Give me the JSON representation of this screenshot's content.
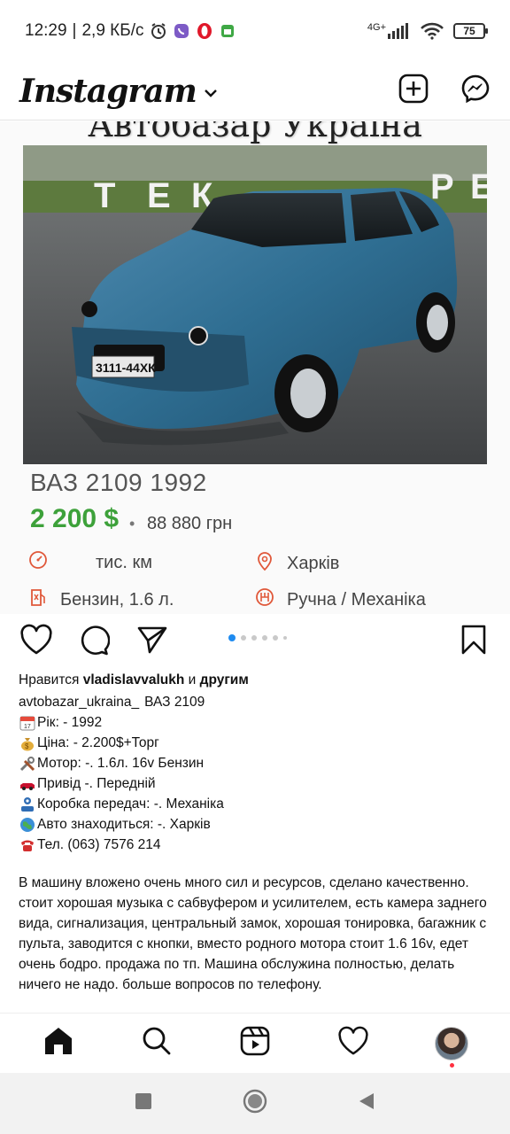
{
  "status": {
    "time": "12:29",
    "separator": "|",
    "speed": "2,9 КБ/с",
    "network": "4G+",
    "battery": "75"
  },
  "header": {
    "logo": "Instagram"
  },
  "post": {
    "image_title": "Автобазар Україна",
    "plate": "3111-44ХК",
    "car_title": "ВАЗ 2109  1992",
    "price": "2 200 $",
    "price_dot": "•",
    "price_uah": "88 880 грн",
    "specs": {
      "mileage": "тис. км",
      "city": "Харків",
      "fuel": "Бензин, 1.6 л.",
      "transmission": "Ручна / Механіка"
    },
    "carousel": {
      "count": 6,
      "active_index": 0
    }
  },
  "caption": {
    "likes_prefix": "Нравится",
    "likes_user": "vladislavvalukh",
    "likes_and": "и",
    "likes_others": "другим",
    "username": "avtobazar_ukraina_",
    "username_text": "ВАЗ 2109",
    "lines": [
      {
        "icon": "calendar-icon",
        "text": "Рік: - 1992"
      },
      {
        "icon": "money-bag-icon",
        "text": "Ціна: - 2.200$+Торг"
      },
      {
        "icon": "tools-icon",
        "text": "Мотор: -. 1.6л. 16v Бензин"
      },
      {
        "icon": "car-icon",
        "text": "Привід -. Передній"
      },
      {
        "icon": "gearbox-icon",
        "text": "Коробка передач: -. Механіка"
      },
      {
        "icon": "globe-icon",
        "text": "Авто знаходиться: -. Харків"
      },
      {
        "icon": "telephone-icon",
        "text": "Тел. (063) 7576 214"
      }
    ],
    "paragraph": "В машину вложено очень много сил и ресурсов, сделано качественно. стоит хорошая музыка с сабвуфером и усилителем, есть камера заднего вида, сигнализация, центральный замок, хорошая тонировка, багажник с пульта, заводится с кнопки, вместо родного мотора стоит 1.6 16v, едет очень бодро. продажа по тп. Машина обслужина полностью, делать ничего не надо. больше вопросов по телефону."
  },
  "colors": {
    "price_green": "#3da13a",
    "carousel_active": "#1e8bf0",
    "notification_red": "#ff3040"
  }
}
